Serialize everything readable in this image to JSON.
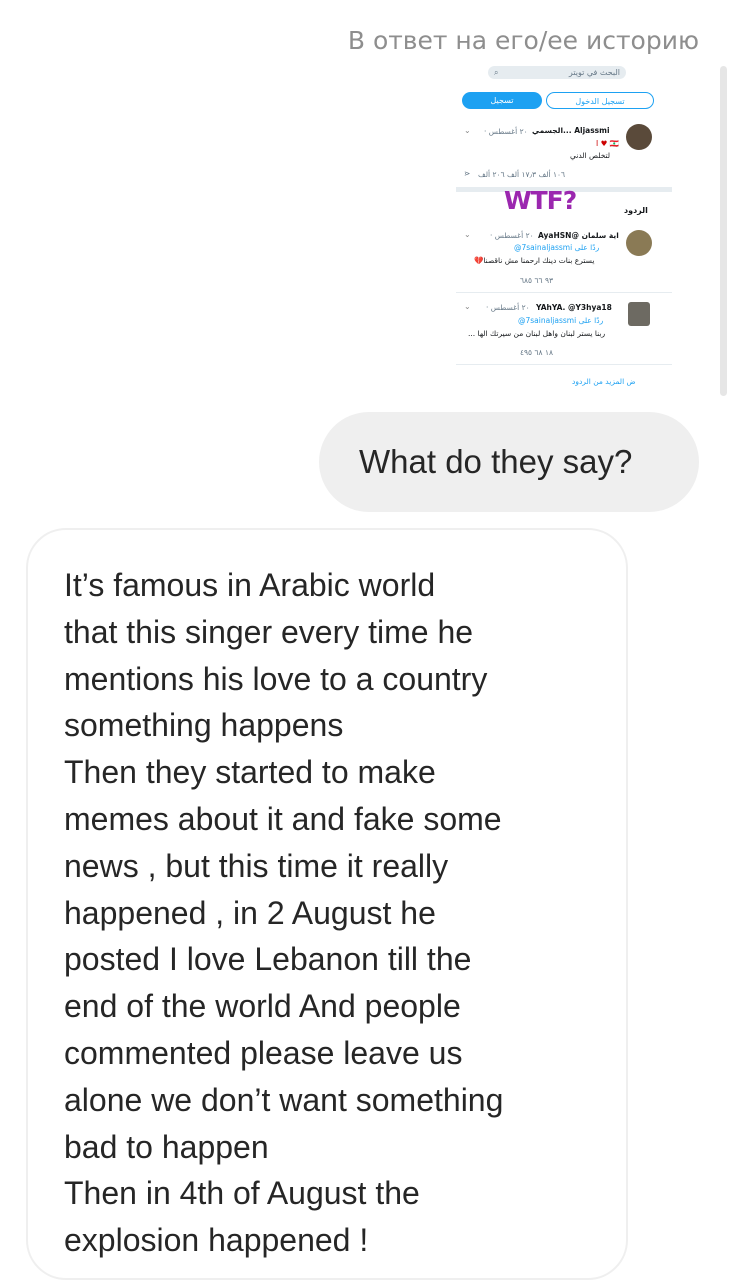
{
  "reply_note": "В ответ на его/ее историю",
  "story": {
    "search_placeholder": "البحث في تويتر",
    "login_label": "تسجيل الدخول",
    "signup_label": "تسجيل",
    "tweet": {
      "author": "Aljassmi ...الجسمي",
      "date": "٢٠ أغسطس ·",
      "line1": "I ♥ 🇱🇧",
      "line2": "لتخلص الدني",
      "stats": "١٠٦ ألف   ١٧٫٣ ألف   ٢٠٦ ألف"
    },
    "overlay": "WTF?",
    "replies_header": "الردود",
    "replies": [
      {
        "author": "اية سلمان @AyaHSN",
        "date": "٢٠ أغسطس ·",
        "reply_to": "ردًا على 7sainaljassmi@",
        "text": "يسترع بنات دينك ارحمنا مش ناقصنا💔",
        "stats": "٩٣   ٦٦   ٦٨٥"
      },
      {
        "author": "YAhYA. @Y3hya18",
        "date": "٢٠ أغسطس ·",
        "reply_to": "ردًا على 7sainaljassmi@",
        "text": "ربنا يستر لبنان واهل لبنان من سيرتك الها ...",
        "stats": "١٨   ٦٨   ٤٩٥"
      }
    ],
    "more_replies": "ض المزيد من الردود"
  },
  "outgoing_message": "What do they say?",
  "incoming_message": "It’s famous in Arabic world\nthat this singer every time he\nmentions  his love to a country\nsomething happens\nThen they started to make\nmemes about it and fake some\nnews , but this time it really\nhappened , in 2 August he\nposted I love Lebanon till the\nend of the world And people\ncommented please leave us\nalone we don’t want something\nbad to happen\nThen in 4th  of August the\nexplosion happened !",
  "colors": {
    "twitter_blue": "#1da1f2",
    "overlay_purple": "#9b27af",
    "bubble_gray": "#efefef"
  }
}
